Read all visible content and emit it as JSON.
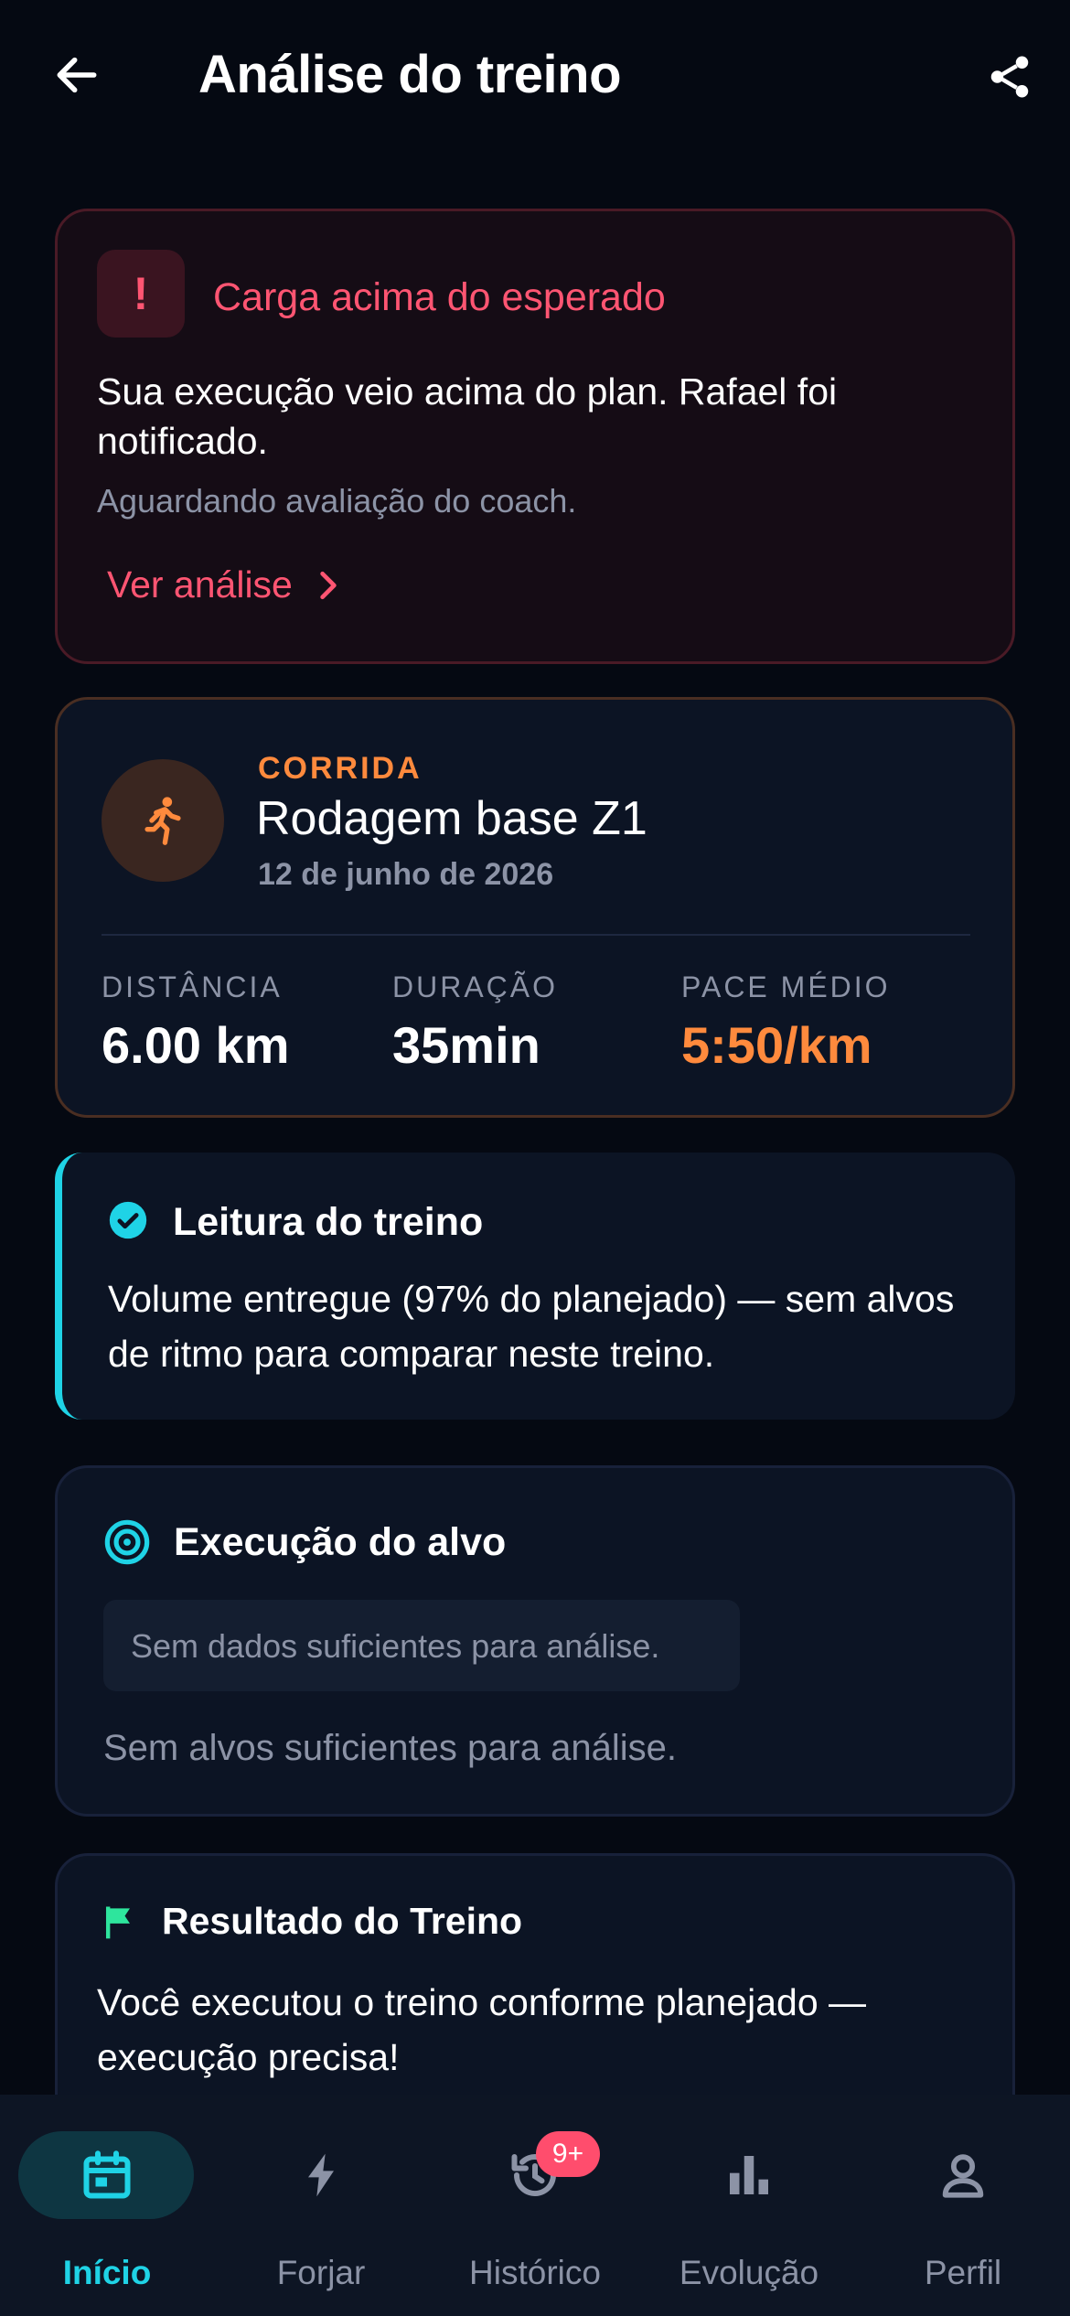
{
  "header": {
    "title": "Análise do treino",
    "back_icon": "arrow-left-icon",
    "share_icon": "share-icon"
  },
  "alert": {
    "icon": "!",
    "title": "Carga acima do esperado",
    "body": "Sua execução veio acima do plan. Rafael foi notificado.",
    "subtext": "Aguardando avaliação do coach.",
    "link_label": "Ver análise",
    "color": "#ff5572"
  },
  "workout": {
    "category": "CORRIDA",
    "title": "Rodagem base Z1",
    "date": "12 de junho de 2026",
    "stats": [
      {
        "label": "DISTÂNCIA",
        "value": "6.00 km"
      },
      {
        "label": "DURAÇÃO",
        "value": "35min"
      },
      {
        "label": "PACE MÉDIO",
        "value": "5:50/km"
      }
    ],
    "accent": "#ff8a3d"
  },
  "reading": {
    "title": "Leitura do treino",
    "body": "Volume entregue (97% do planejado) — sem alvos de ritmo para comparar neste treino.",
    "accent": "#1fd3e6"
  },
  "target": {
    "title": "Execução do alvo",
    "box_text": "Sem dados suficientes para análise.",
    "subtext": "Sem alvos suficientes para análise."
  },
  "result": {
    "title": "Resultado do Treino",
    "body": "Você executou o treino conforme planejado — execução precisa!",
    "flag_color": "#2ee59d"
  },
  "nav": {
    "items": [
      {
        "label": "Início",
        "icon": "calendar-icon",
        "active": true
      },
      {
        "label": "Forjar",
        "icon": "lightning-icon",
        "active": false
      },
      {
        "label": "Histórico",
        "icon": "history-icon",
        "active": false
      },
      {
        "label": "Evolução",
        "icon": "bar-chart-icon",
        "active": false
      },
      {
        "label": "Perfil",
        "icon": "person-icon",
        "active": false
      }
    ],
    "history_badge": "9+"
  }
}
